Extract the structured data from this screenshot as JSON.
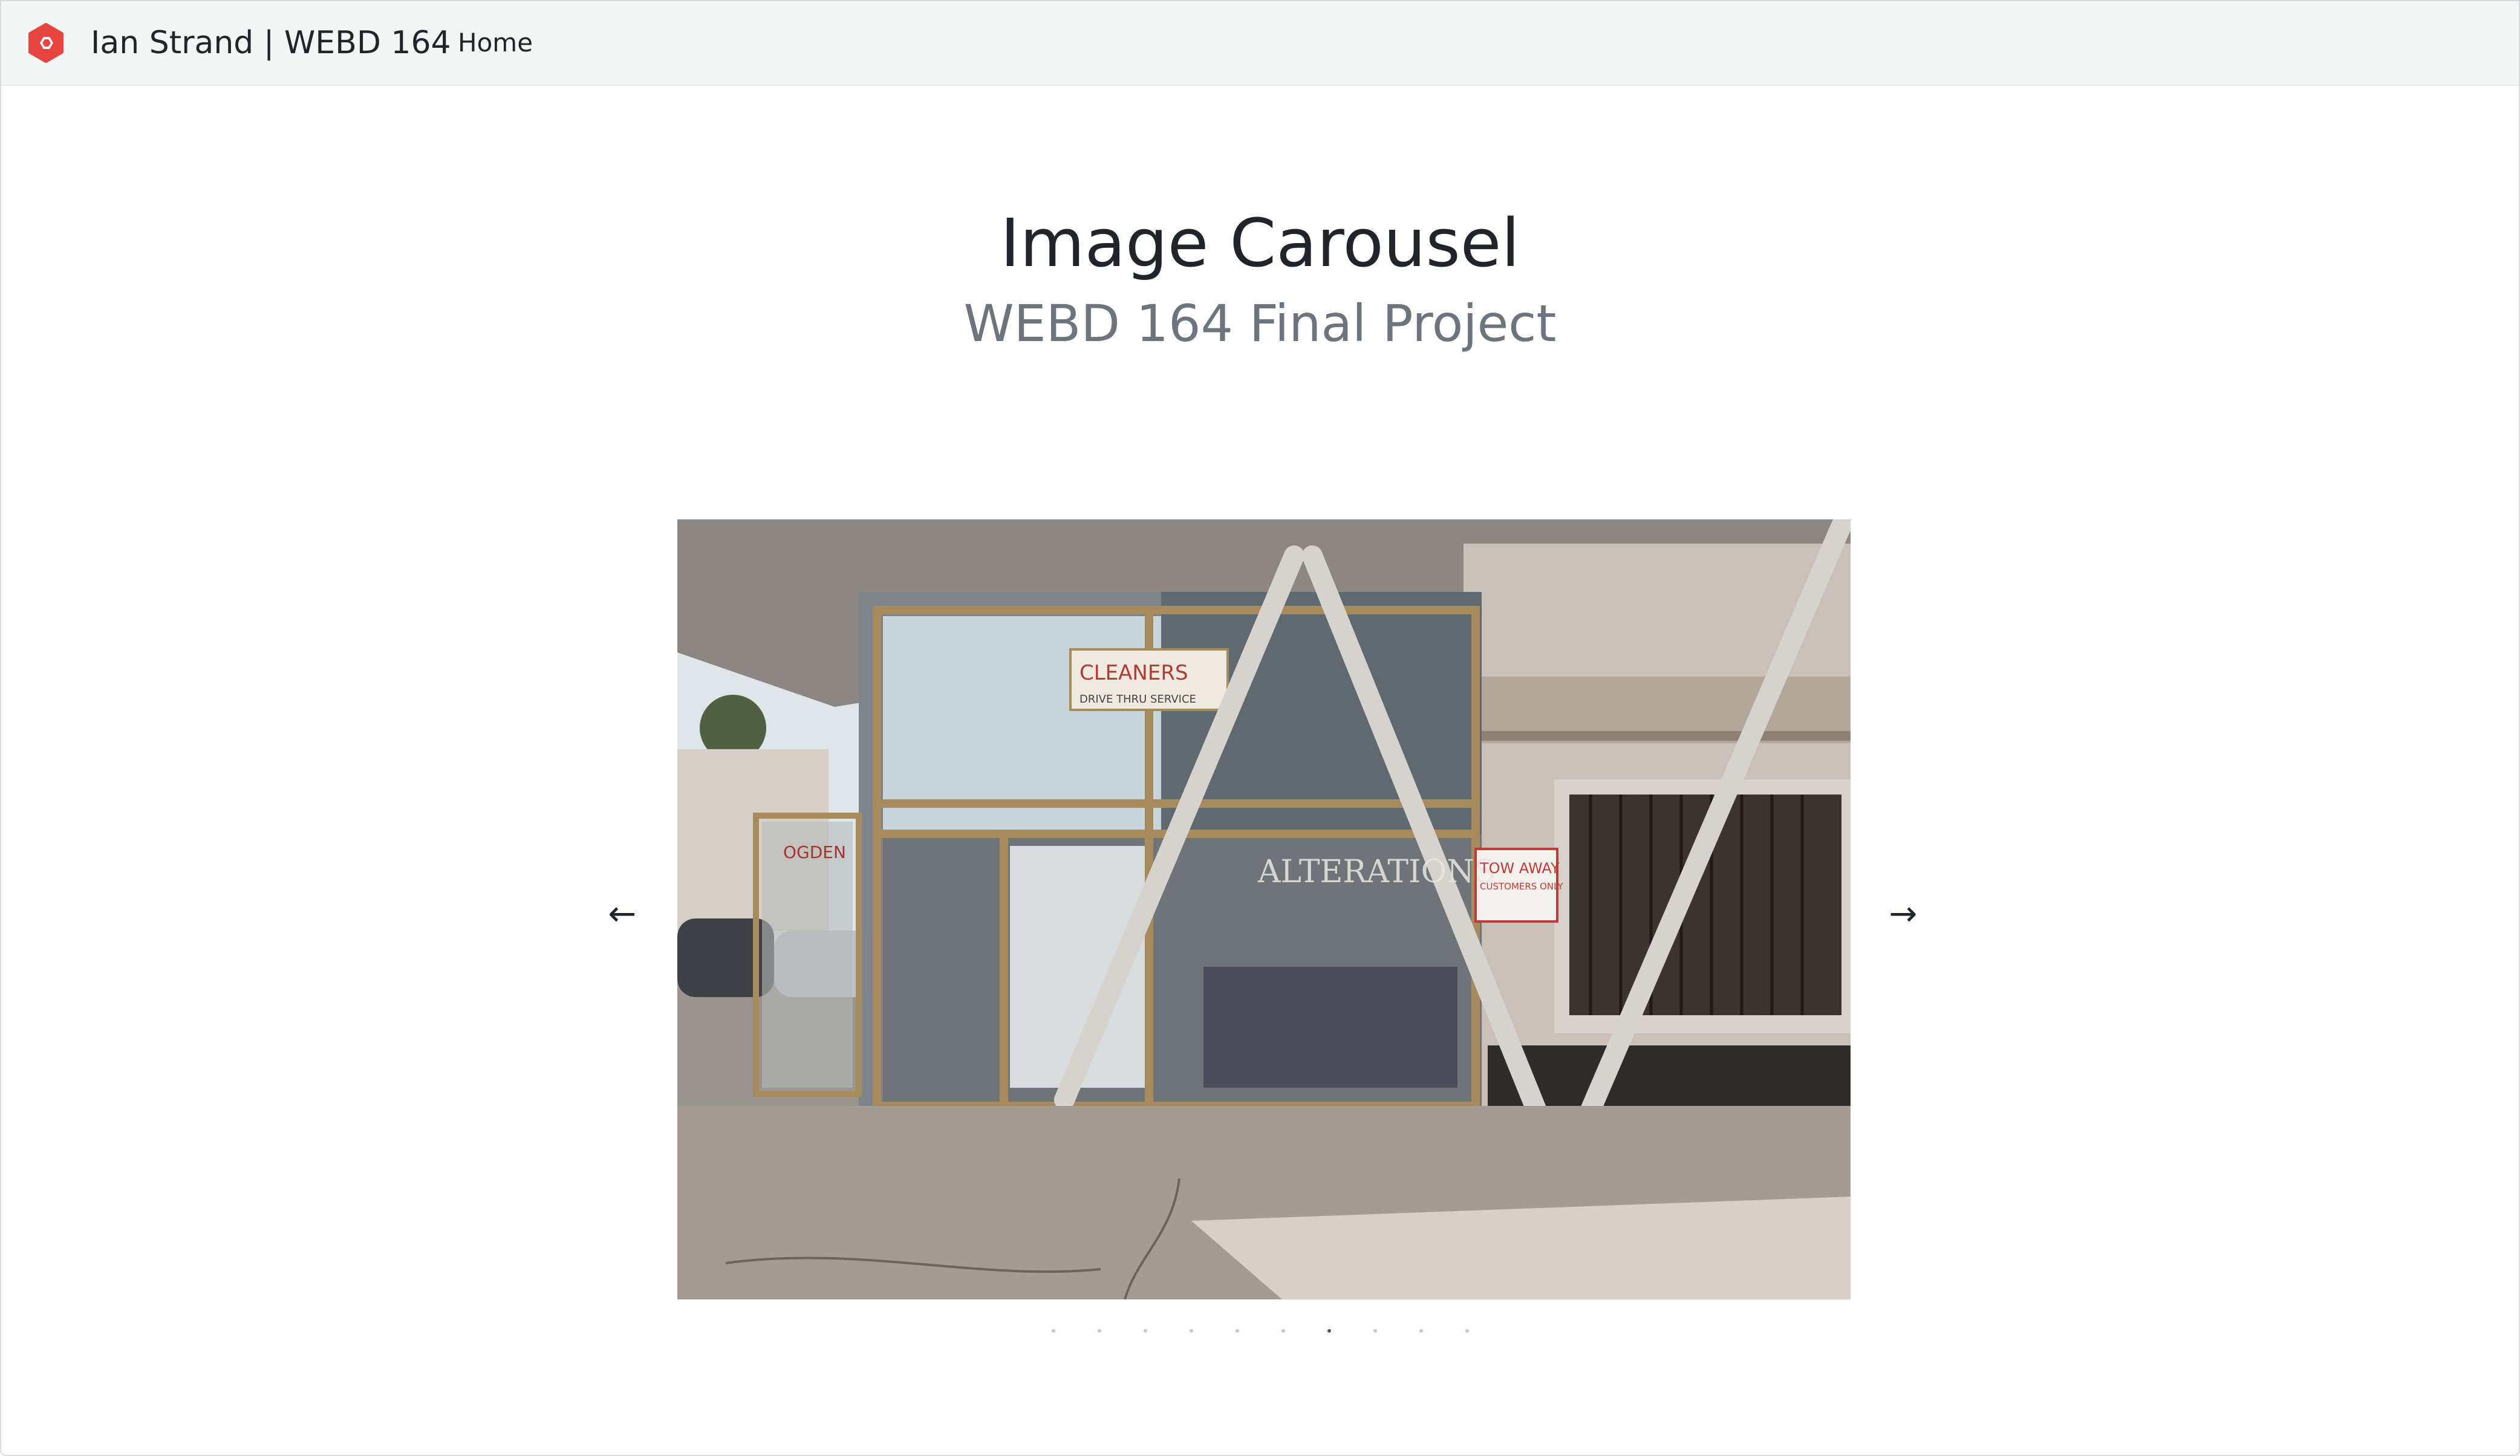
{
  "navbar": {
    "logo_icon": "hexagon-logo-icon",
    "brand": "Ian Strand | WEBD 164",
    "links": [
      {
        "label": "Home"
      }
    ]
  },
  "header": {
    "title": "Image Carousel",
    "subtitle": "WEBD 164 Final Project"
  },
  "carousel": {
    "prev_label": "←",
    "next_label": "→",
    "slide_count": 10,
    "active_index": 6,
    "slide_text": {
      "door_sign": "OGDEN",
      "window_sign": "CLEANERS",
      "window_sign_sub": "DRIVE THRU SERVICE",
      "window_lettering": "ALTERATIONS",
      "tow_sign_1": "TOW AWAY",
      "tow_sign_2": "CUSTOMERS ONLY"
    }
  },
  "colors": {
    "navbar_bg": "#f4f6f6",
    "logo": "#e8443f",
    "text": "#212529",
    "muted": "#6c757d"
  }
}
